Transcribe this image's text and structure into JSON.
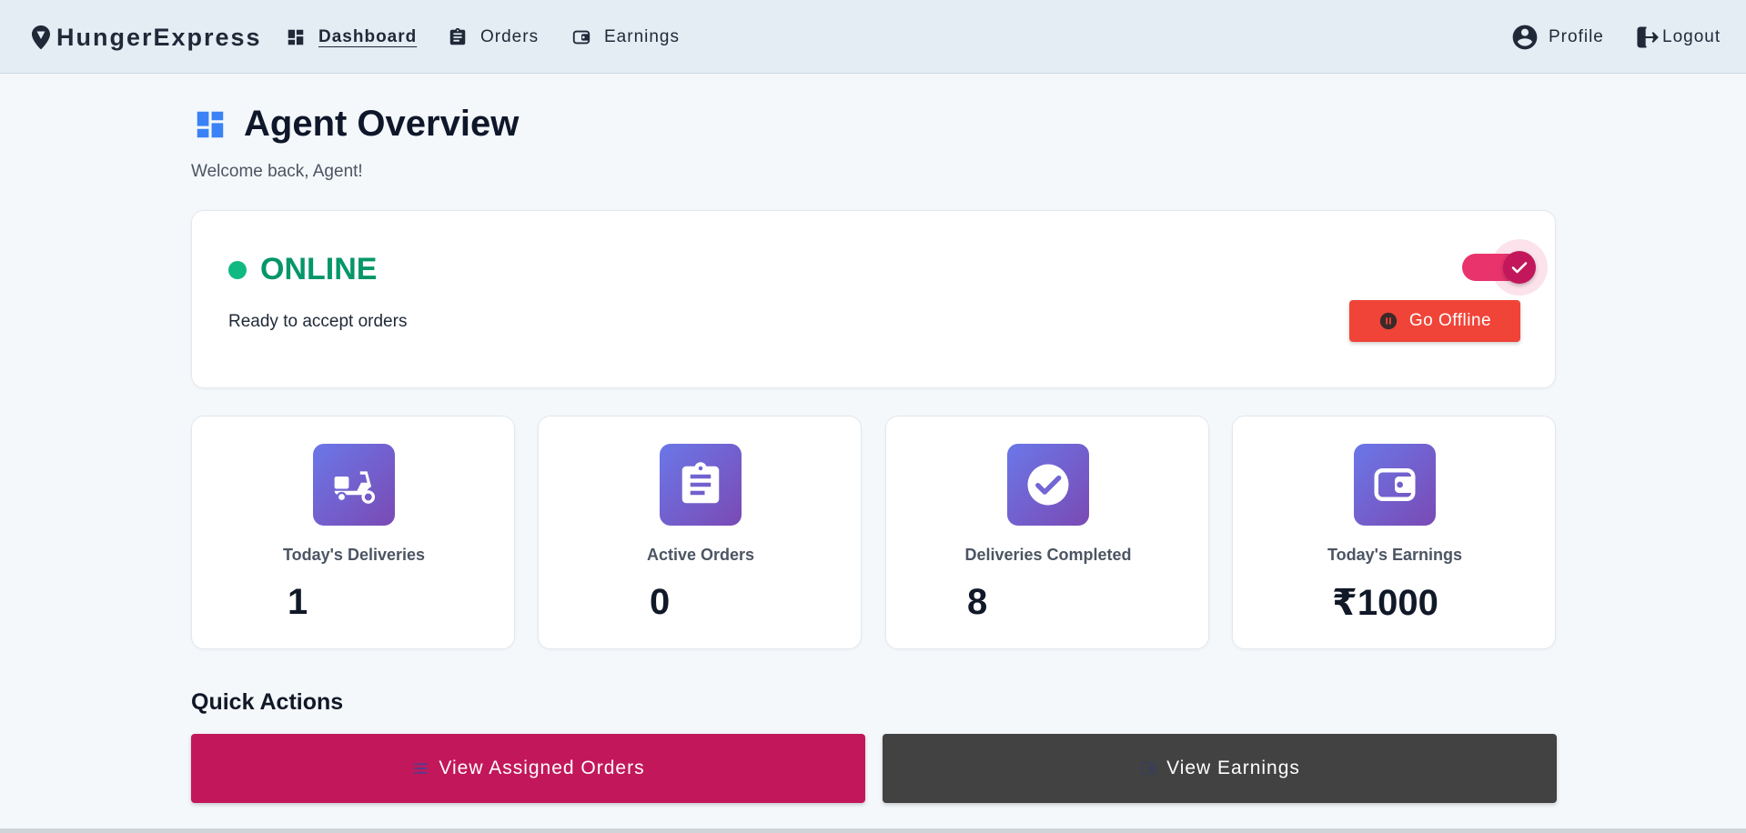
{
  "navbar": {
    "brand": "HungerExpress",
    "links": [
      {
        "label": "Dashboard",
        "icon": "dashboard-icon",
        "active": true
      },
      {
        "label": "Orders",
        "icon": "clipboard-icon"
      },
      {
        "label": "Earnings",
        "icon": "wallet-icon"
      }
    ],
    "profile_label": "Profile",
    "logout_label": "Logout"
  },
  "page": {
    "title": "Agent Overview",
    "welcome": "Welcome back, Agent!"
  },
  "status": {
    "state": "ONLINE",
    "subtitle": "Ready to accept orders",
    "toggle_on": true,
    "go_offline_label": "Go Offline"
  },
  "stats": [
    {
      "label": "Today's Deliveries",
      "value": "1",
      "icon": "scooter-icon"
    },
    {
      "label": "Active Orders",
      "value": "0",
      "icon": "clipboard-icon"
    },
    {
      "label": "Deliveries Completed",
      "value": "8",
      "icon": "check-circle-icon"
    },
    {
      "label": "Today's Earnings",
      "value": "₹1000",
      "icon": "wallet-icon"
    }
  ],
  "quick_actions": {
    "title": "Quick Actions",
    "view_orders_label": "View Assigned Orders",
    "view_earnings_label": "View Earnings"
  },
  "colors": {
    "online_green": "#059669",
    "primary_pink": "#c2185b",
    "offline_red": "#f04438",
    "dark_button": "#424242",
    "accent_blue": "#3b82f6",
    "stat_gradient_start": "#6b77e8",
    "stat_gradient_end": "#7a4ab4"
  }
}
